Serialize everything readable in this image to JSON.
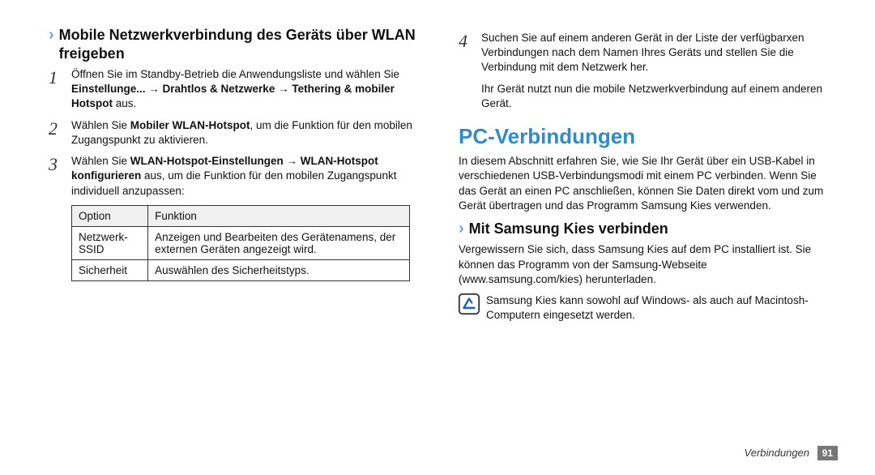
{
  "left": {
    "subheading": "Mobile Netzwerkverbindung des Geräts über WLAN freigeben",
    "step1_a": "Öffnen Sie im Standby-Betrieb die Anwendungsliste und wählen Sie ",
    "step1_b": "Einstellunge...",
    "step1_c": " → ",
    "step1_d": "Drahtlos & Netzwerke",
    "step1_e": " → ",
    "step1_f": "Tethering & mobiler Hotspot",
    "step1_g": " aus.",
    "step2_a": "Wählen Sie ",
    "step2_b": "Mobiler WLAN-Hotspot",
    "step2_c": ", um die Funktion für den mobilen Zugangspunkt zu aktivieren.",
    "step3_a": "Wählen Sie ",
    "step3_b": "WLAN-Hotspot-Einstellungen",
    "step3_c": " → ",
    "step3_d": "WLAN-Hotspot konfigurieren",
    "step3_e": " aus, um die Funktion für den mobilen Zugangspunkt individuell anzupassen:",
    "table": {
      "h1": "Option",
      "h2": "Funktion",
      "r1c1": "Netzwerk-SSID",
      "r1c2": "Anzeigen und Bearbeiten des Gerätenamens, der externen Geräten angezeigt wird.",
      "r2c1": "Sicherheit",
      "r2c2": "Auswählen des Sicherheitstyps."
    }
  },
  "right": {
    "step4_a": "Suchen Sie auf einem anderen Gerät in der Liste der verfügbarxen Verbindungen nach dem Namen Ihres Geräts und stellen Sie die Verbindung mit dem Netzwerk her.",
    "step4_b": "Ihr Gerät nutzt nun die mobile Netzwerkverbindung auf einem anderen Gerät.",
    "major": "PC-Verbindungen",
    "intro": "In diesem Abschnitt erfahren Sie, wie Sie Ihr Gerät über ein USB-Kabel in verschiedenen USB-Verbindungsmodi mit einem PC verbinden. Wenn Sie das Gerät an einen PC anschließen, können Sie Daten direkt vom und zum Gerät übertragen und das Programm Samsung Kies verwenden.",
    "sub2": "Mit Samsung Kies verbinden",
    "kies": "Vergewissern Sie sich, dass Samsung Kies auf dem PC installiert ist. Sie können das Programm von der Samsung-Webseite (www.samsung.com/kies) herunterladen.",
    "note": "Samsung Kies kann sowohl auf Windows- als auch auf Macintosh-Computern eingesetzt werden."
  },
  "footer": {
    "section": "Verbindungen",
    "page": "91"
  },
  "nums": {
    "n1": "1",
    "n2": "2",
    "n3": "3",
    "n4": "4"
  },
  "chev": "›"
}
